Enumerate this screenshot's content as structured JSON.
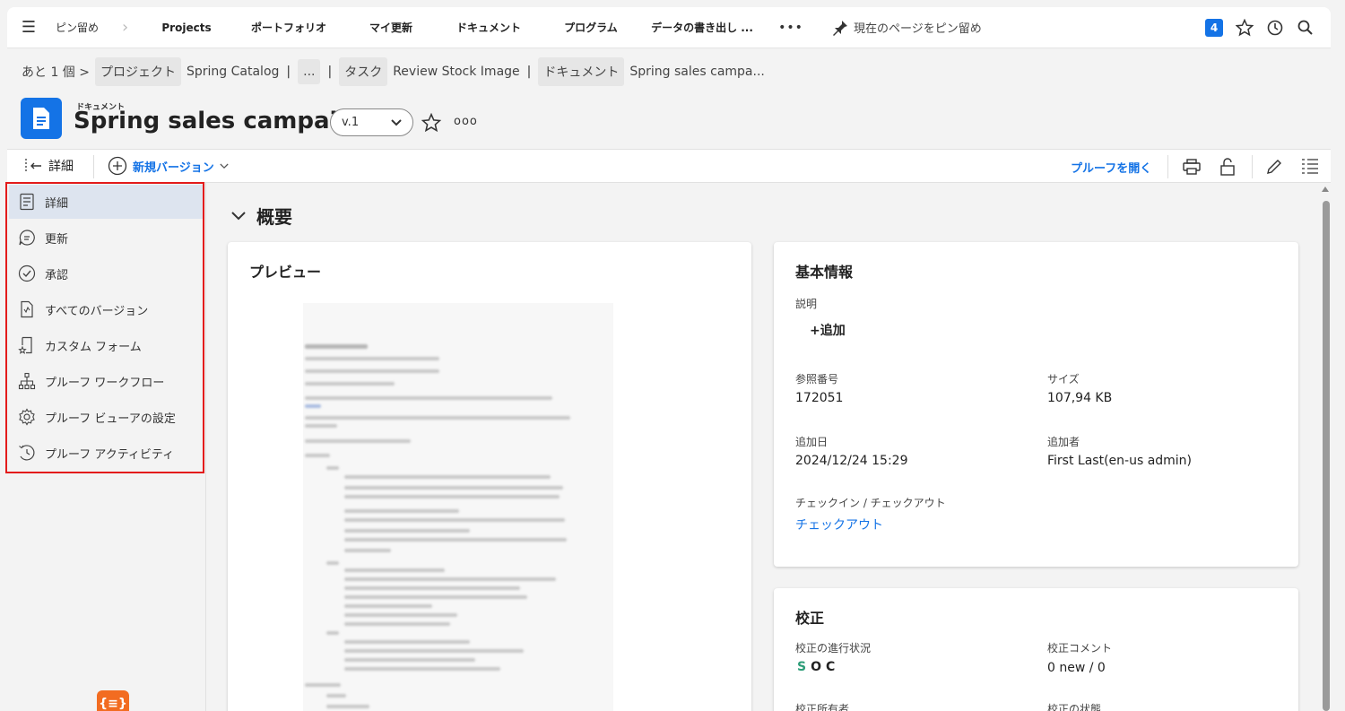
{
  "topnav": {
    "pinned_label": "ピン留め",
    "items": [
      "Projects",
      "ポートフォリオ",
      "マイ更新",
      "ドキュメント",
      "プログラム",
      "データの書き出し ..."
    ],
    "more": "•••",
    "pin_page_label": "現在のページをピン留め",
    "notification_count": "4"
  },
  "breadcrumb": {
    "more": "あと 1 個 >",
    "project_chip": "プロジェクト",
    "project_name": "Spring Catalog",
    "sep": "|",
    "ellipsis": "...",
    "task_chip": "タスク",
    "task_name": "Review Stock Image",
    "document_chip": "ドキュメント",
    "document_name": "Spring sales campa..."
  },
  "header": {
    "type_label": "ドキュメント",
    "title": "Spring sales campaign",
    "version": "v.1",
    "more": "ooo"
  },
  "toolbar": {
    "details_label": "詳細",
    "new_version_label": "新規バージョン",
    "open_proof_label": "プルーフを開く"
  },
  "sidebar": {
    "items": [
      {
        "label": "詳細",
        "icon": "document-details-icon"
      },
      {
        "label": "更新",
        "icon": "comment-icon"
      },
      {
        "label": "承認",
        "icon": "check-circle-icon"
      },
      {
        "label": "すべてのバージョン",
        "icon": "file-versions-icon"
      },
      {
        "label": "カスタム フォーム",
        "icon": "custom-form-icon"
      },
      {
        "label": "プルーフ ワークフロー",
        "icon": "workflow-icon"
      },
      {
        "label": "プルーフ ビューアの設定",
        "icon": "gear-icon"
      },
      {
        "label": "プルーフ アクティビティ",
        "icon": "activity-icon"
      }
    ]
  },
  "main": {
    "section_title": "概要",
    "preview": {
      "title": "プレビュー"
    },
    "basic_info": {
      "title": "基本情報",
      "description_label": "説明",
      "add_label": "+追加",
      "ref_label": "参照番号",
      "ref_value": "172051",
      "size_label": "サイズ",
      "size_value": "107,94 KB",
      "added_date_label": "追加日",
      "added_date_value": "2024/12/24 15:29",
      "added_by_label": "追加者",
      "added_by_value": "First Last(en-us admin)",
      "checkin_label": "チェックイン / チェックアウト",
      "checkout_link": "チェックアウト"
    },
    "proof": {
      "title": "校正",
      "progress_label": "校正の進行状況",
      "progress_s": "S",
      "progress_o": "O",
      "progress_c": "C",
      "comments_label": "校正コメント",
      "comments_value": "0 new / 0",
      "owner_label": "校正所有者",
      "status_label": "校正の状態"
    }
  },
  "colors": {
    "accent": "#1473e6",
    "highlight_border": "#e31b1b",
    "logo": "#f26c21"
  }
}
